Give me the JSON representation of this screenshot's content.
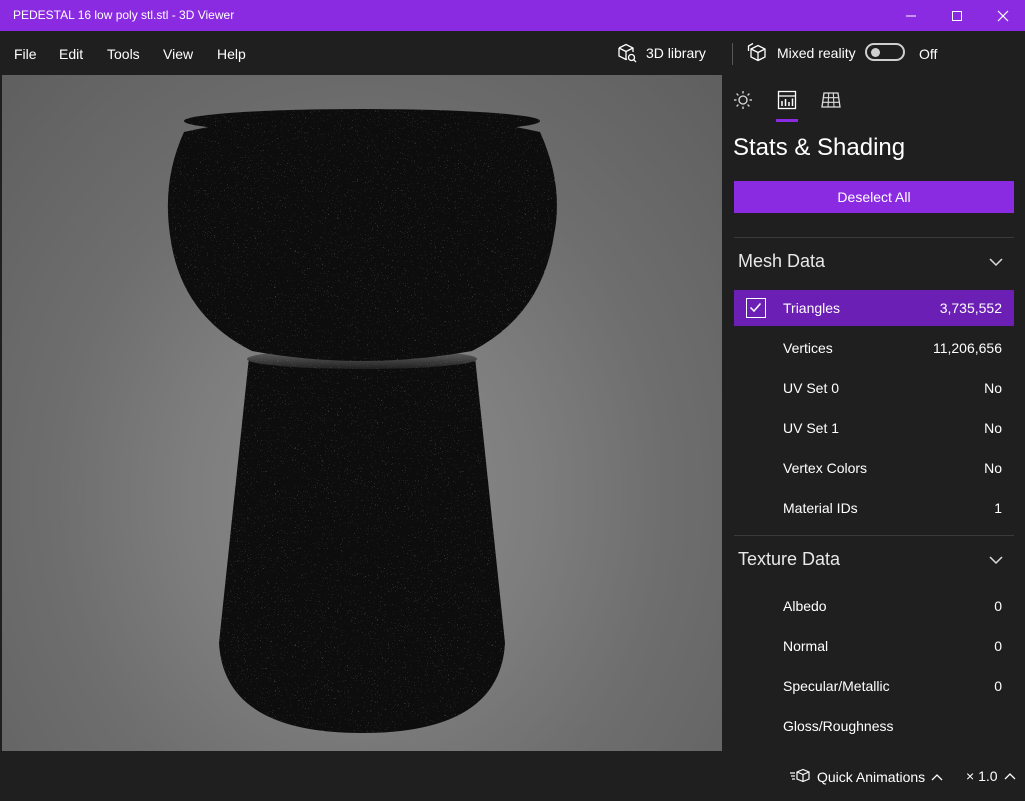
{
  "window": {
    "title": "PEDESTAL 16 low poly stl.stl - 3D Viewer",
    "controls": [
      "minimize-icon",
      "maximize-icon",
      "close-icon"
    ],
    "accent_color": "#8a2be2"
  },
  "menu": {
    "items": [
      "File",
      "Edit",
      "Tools",
      "View",
      "Help"
    ]
  },
  "toolbar": {
    "library_label": "3D library",
    "mixed_reality_label": "Mixed reality",
    "toggle_state_label": "Off",
    "toggle_on": false
  },
  "panel": {
    "tabs": [
      "lighting-icon",
      "stats-icon",
      "grid-icon"
    ],
    "active_tab": "stats-icon",
    "title": "Stats & Shading",
    "deselect_label": "Deselect All",
    "mesh": {
      "heading": "Mesh Data",
      "rows": [
        {
          "label": "Triangles",
          "value": "3,735,552",
          "checked": true
        },
        {
          "label": "Vertices",
          "value": "11,206,656"
        },
        {
          "label": "UV Set 0",
          "value": "No"
        },
        {
          "label": "UV Set 1",
          "value": "No"
        },
        {
          "label": "Vertex Colors",
          "value": "No"
        },
        {
          "label": "Material IDs",
          "value": "1"
        }
      ]
    },
    "texture": {
      "heading": "Texture Data",
      "rows": [
        {
          "label": "Albedo",
          "value": "0"
        },
        {
          "label": "Normal",
          "value": "0"
        },
        {
          "label": "Specular/Metallic",
          "value": "0"
        },
        {
          "label": "Gloss/Roughness",
          "value": ""
        }
      ]
    }
  },
  "bottom": {
    "animations_label": "Quick Animations",
    "speed_label": "× 1.0"
  }
}
